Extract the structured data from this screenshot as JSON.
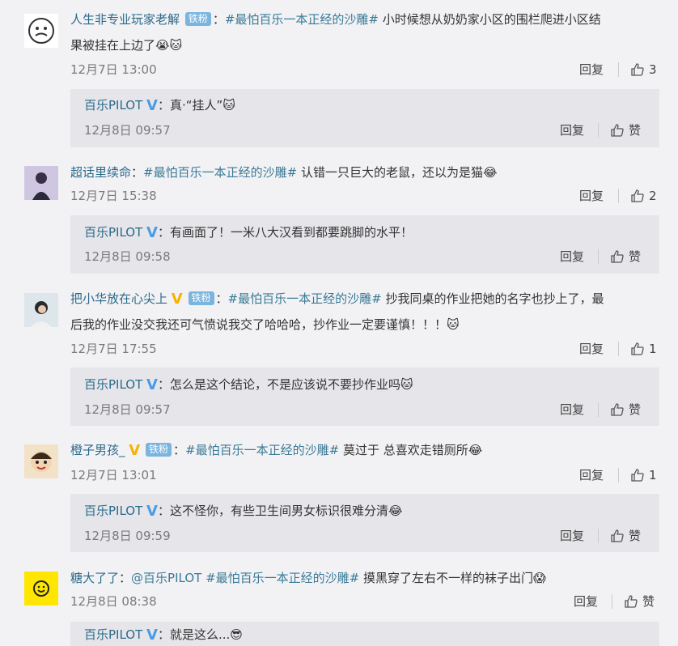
{
  "colors": {
    "link": "#2a6a8a",
    "topic": "#3a7a96",
    "badge": "#7ab4df",
    "v_blue": "#4a9be6",
    "v_gold": "#f5b400"
  },
  "labels": {
    "reply": "回复",
    "like": "赞",
    "badge": "铁粉",
    "v": "V"
  },
  "comments": [
    {
      "user": "人生非专业玩家老解",
      "badge": "铁粉",
      "sep": "：",
      "topic": "#最怕百乐一本正经的沙雕#",
      "text1": " 小时候想从奶奶家小区的围栏爬进小区结",
      "text2": "果被挂在上边了😭🐱",
      "time": "12月7日 13:00",
      "likes": "3",
      "reply": {
        "user": "百乐PILOT",
        "sep": "：",
        "text": "真·“挂人”🐱",
        "time": "12月8日 09:57",
        "like": "赞"
      }
    },
    {
      "user": "超话里续命",
      "sep": "：",
      "topic": "#最怕百乐一本正经的沙雕#",
      "text1": " 认错一只巨大的老鼠，还以为是猫😂",
      "time": "12月7日 15:38",
      "likes": "2",
      "reply": {
        "user": "百乐PILOT",
        "sep": "：",
        "text": "有画面了！一米八大汉看到都要跳脚的水平！",
        "time": "12月8日 09:58",
        "like": "赞"
      }
    },
    {
      "user": "把小华放在心尖上",
      "badge": "铁粉",
      "sep": "：",
      "topic": "#最怕百乐一本正经的沙雕#",
      "text1": " 抄我同桌的作业把她的名字也抄上了，最",
      "text2": "后我的作业没交我还可气愤说我交了哈哈哈，抄作业一定要谨慎！！！🐱",
      "time": "12月7日 17:55",
      "likes": "1",
      "reply": {
        "user": "百乐PILOT",
        "sep": "：",
        "text": "怎么是这个结论，不是应该说不要抄作业吗🐱",
        "time": "12月8日 09:57",
        "like": "赞"
      }
    },
    {
      "user": "橙子男孩_",
      "badge": "铁粉",
      "sep": "：",
      "topic": "#最怕百乐一本正经的沙雕#",
      "text1": " 莫过于 总喜欢走错厕所😂",
      "time": "12月7日 13:01",
      "likes": "1",
      "reply": {
        "user": "百乐PILOT",
        "sep": "：",
        "text": "这不怪你，有些卫生间男女标识很难分清😂",
        "time": "12月8日 09:59",
        "like": "赞"
      }
    },
    {
      "user": "糖大了了",
      "sep": "：",
      "mention": "@百乐PILOT",
      "topic": " #最怕百乐一本正经的沙雕#",
      "text1": " 摸黑穿了左右不一样的袜子出门😱",
      "time": "12月8日 08:38",
      "like_label": "赞",
      "reply": {
        "user": "百乐PILOT",
        "sep": "：",
        "text": "就是这么...😎"
      }
    }
  ]
}
